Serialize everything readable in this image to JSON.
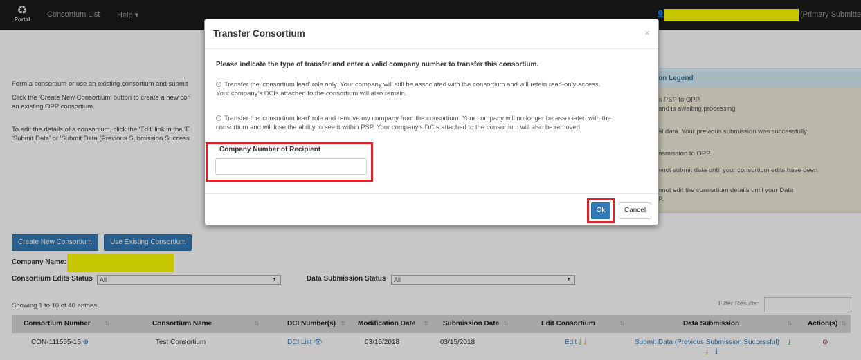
{
  "navbar": {
    "logo_text": "Portal",
    "logo_icon": "portal-logo-icon",
    "consortium_list": "Consortium List",
    "help": "Help ▾",
    "user_icon": "user-icon",
    "user_role": "(Primary Submitter)"
  },
  "intro": {
    "line1": "Form a consortium or use an existing consortium and submit",
    "line2": "Click the 'Create New Consortium' button to create a new con",
    "line3": "an existing OPP consortium.",
    "line4": "To edit the details of a consortium, click the 'Edit' link in the 'E",
    "line5": "'Submit Data' or 'Submit Data (Previous Submission Success"
  },
  "legend": {
    "title": "on Legend",
    "line1": "n PSP to OPP.",
    "line2": "and is awaiting processing.",
    "line3": "al data. Your previous submission was successfully",
    "line4": "nsmission to OPP.",
    "line5": "nnot submit data until your consortium edits have been",
    "line6": "nnot edit the consortium details until your Data",
    "line7": "P."
  },
  "actions": {
    "create": "Create New Consortium",
    "use_existing": "Use Existing Consortium"
  },
  "filters": {
    "company_name_label": "Company Name:",
    "edits_status_label": "Consortium Edits Status",
    "edits_status_value": "All",
    "submission_status_label": "Data Submission Status",
    "submission_status_value": "All"
  },
  "table": {
    "showing": "Showing 1 to 10 of 40 entries",
    "filter_label": "Filter Results:",
    "headers": {
      "number": "Consortium Number",
      "name": "Consortium Name",
      "dci": "DCI Number(s)",
      "mod_date": "Modification Date",
      "sub_date": "Submission Date",
      "edit": "Edit Consortium",
      "data_submission": "Data Submission",
      "actions": "Action(s)"
    },
    "row": {
      "number": "CON-111555-15",
      "name": "Test Consortium",
      "dci": "DCI List",
      "mod_date": "03/15/2018",
      "sub_date": "03/15/2018",
      "edit": "Edit",
      "data_submission": "Submit Data (Previous Submission Successful)"
    }
  },
  "modal": {
    "title": "Transfer Consortium",
    "close": "×",
    "prompt": "Please indicate the type of transfer and enter a valid company number to transfer this consortium.",
    "option1_line1": "Transfer the 'consortium lead' role only. Your company will still be associated with the consortium and will retain read-only access.",
    "option1_line2": "Your company's DCIs attached to the consortium will also remain.",
    "option2_line1": "Transfer the 'consortium lead' role and remove my company from the consortium. Your company will no longer be associated with the",
    "option2_line2": "consortium and will lose the ability to see it within PSP. Your company's DCIs attached to the consortium will also be removed.",
    "recipient_label": "Company Number of Recipient",
    "recipient_value": "",
    "ok": "Ok",
    "cancel": "Cancel"
  },
  "colors": {
    "navbar": "#1c1c1c",
    "primary": "#337ab7",
    "highlight_box": "#d9242c",
    "redaction": "#ffff00"
  }
}
